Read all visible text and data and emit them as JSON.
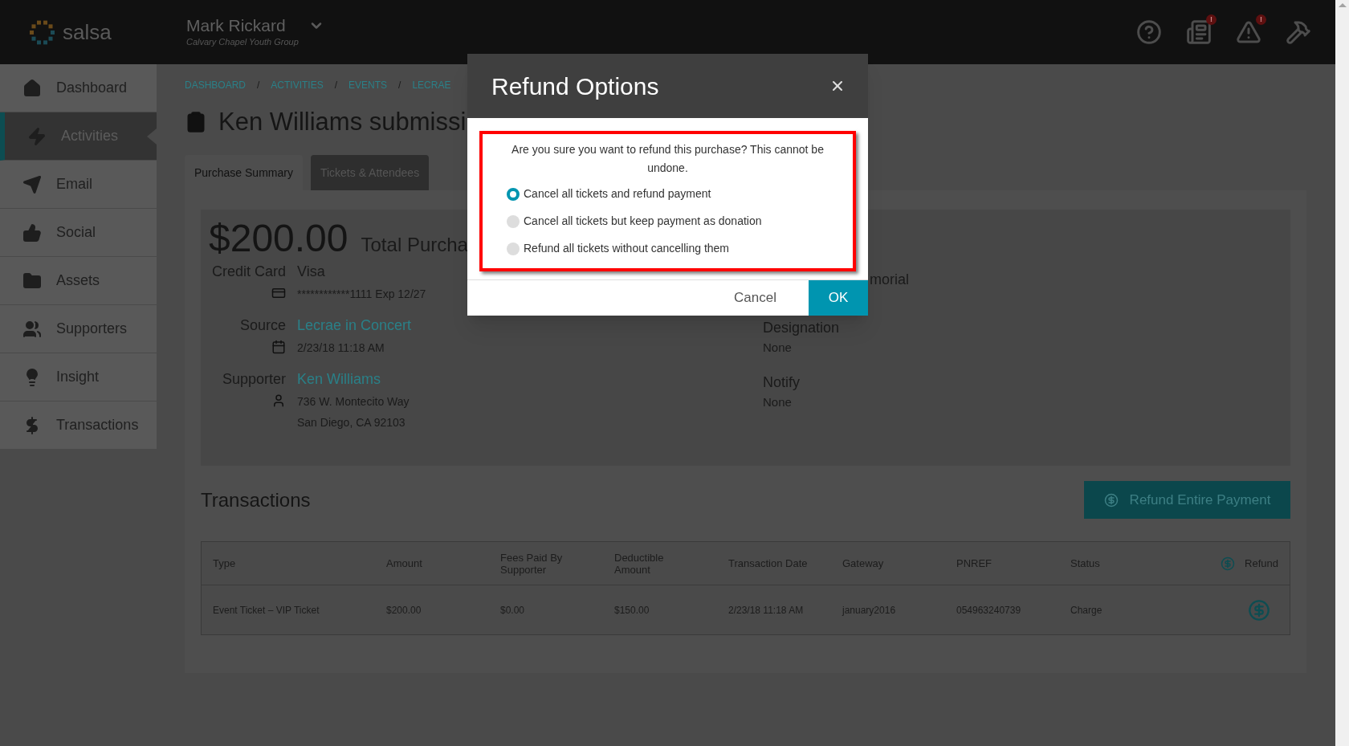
{
  "header": {
    "logo": "salsa",
    "user_name": "Mark Rickard",
    "organization": "Calvary Chapel Youth Group",
    "icons": [
      {
        "kind": "help"
      },
      {
        "kind": "report",
        "badge": "!"
      },
      {
        "kind": "alert",
        "badge": "!"
      },
      {
        "kind": "tools"
      }
    ]
  },
  "sidebar": {
    "items": [
      {
        "label": "Dashboard",
        "selected": false
      },
      {
        "label": "Activities",
        "selected": true
      },
      {
        "label": "Email",
        "selected": false
      },
      {
        "label": "Social",
        "selected": false
      },
      {
        "label": "Assets",
        "selected": false
      },
      {
        "label": "Supporters",
        "selected": false
      },
      {
        "label": "Insight",
        "selected": false
      },
      {
        "label": "Transactions",
        "selected": false
      }
    ]
  },
  "breadcrumb": [
    {
      "kind": "link",
      "text": "DASHBOARD"
    },
    {
      "kind": "separator",
      "text": "/"
    },
    {
      "kind": "link",
      "text": "ACTIVITIES"
    },
    {
      "kind": "separator",
      "text": "/"
    },
    {
      "kind": "link",
      "text": "EVENTS"
    },
    {
      "kind": "separator",
      "text": "/"
    },
    {
      "kind": "link",
      "text": "LECRAE"
    }
  ],
  "page_title": "Ken Williams submissi",
  "tabs": [
    {
      "label": "Purchase Summary",
      "selected": true
    },
    {
      "label": "Tickets & Attendees",
      "selected": false
    }
  ],
  "summary": {
    "amount": "$200.00",
    "amount_label": "Total Purcha",
    "details": [
      {
        "label": "Credit Card",
        "value": "Visa",
        "kind": "text",
        "lines": [
          "************1111 Exp 12/27"
        ]
      },
      {
        "label": "Source",
        "value": "Lecrae in Concert",
        "kind": "link",
        "lines": [
          "2/23/18 11:18 AM"
        ]
      },
      {
        "label": "Supporter",
        "value": "Ken Williams",
        "kind": "link",
        "lines": [
          "736 W. Montecito Way",
          "San Diego, CA 92103"
        ]
      }
    ],
    "right_fields": [
      {
        "label": "morial"
      },
      {
        "label": "Designation",
        "value": "None"
      },
      {
        "label": "Notify",
        "value": "None"
      }
    ]
  },
  "transactions": {
    "title": "Transactions",
    "refund_button": "Refund Entire Payment",
    "columns": [
      "Type",
      "Amount",
      "Fees Paid By Supporter",
      "Deductible Amount",
      "Transaction Date",
      "Gateway",
      "PNREF",
      "Status",
      "Refund"
    ],
    "rows": [
      {
        "cells": [
          "Event Ticket – VIP Ticket",
          "$200.00",
          "$0.00",
          "$150.00",
          "2/23/18 11:18 AM",
          "january2016",
          "054963240739",
          "Charge"
        ]
      }
    ]
  },
  "modal": {
    "title": "Refund Options",
    "message": "Are you sure you want to refund this purchase? This cannot be undone.",
    "options": [
      {
        "label": "Cancel all tickets and refund payment",
        "selected": true
      },
      {
        "label": "Cancel all tickets but keep payment as donation",
        "selected": false
      },
      {
        "label": "Refund all tickets without cancelling them",
        "selected": false
      }
    ],
    "cancel": "Cancel",
    "ok": "OK"
  }
}
